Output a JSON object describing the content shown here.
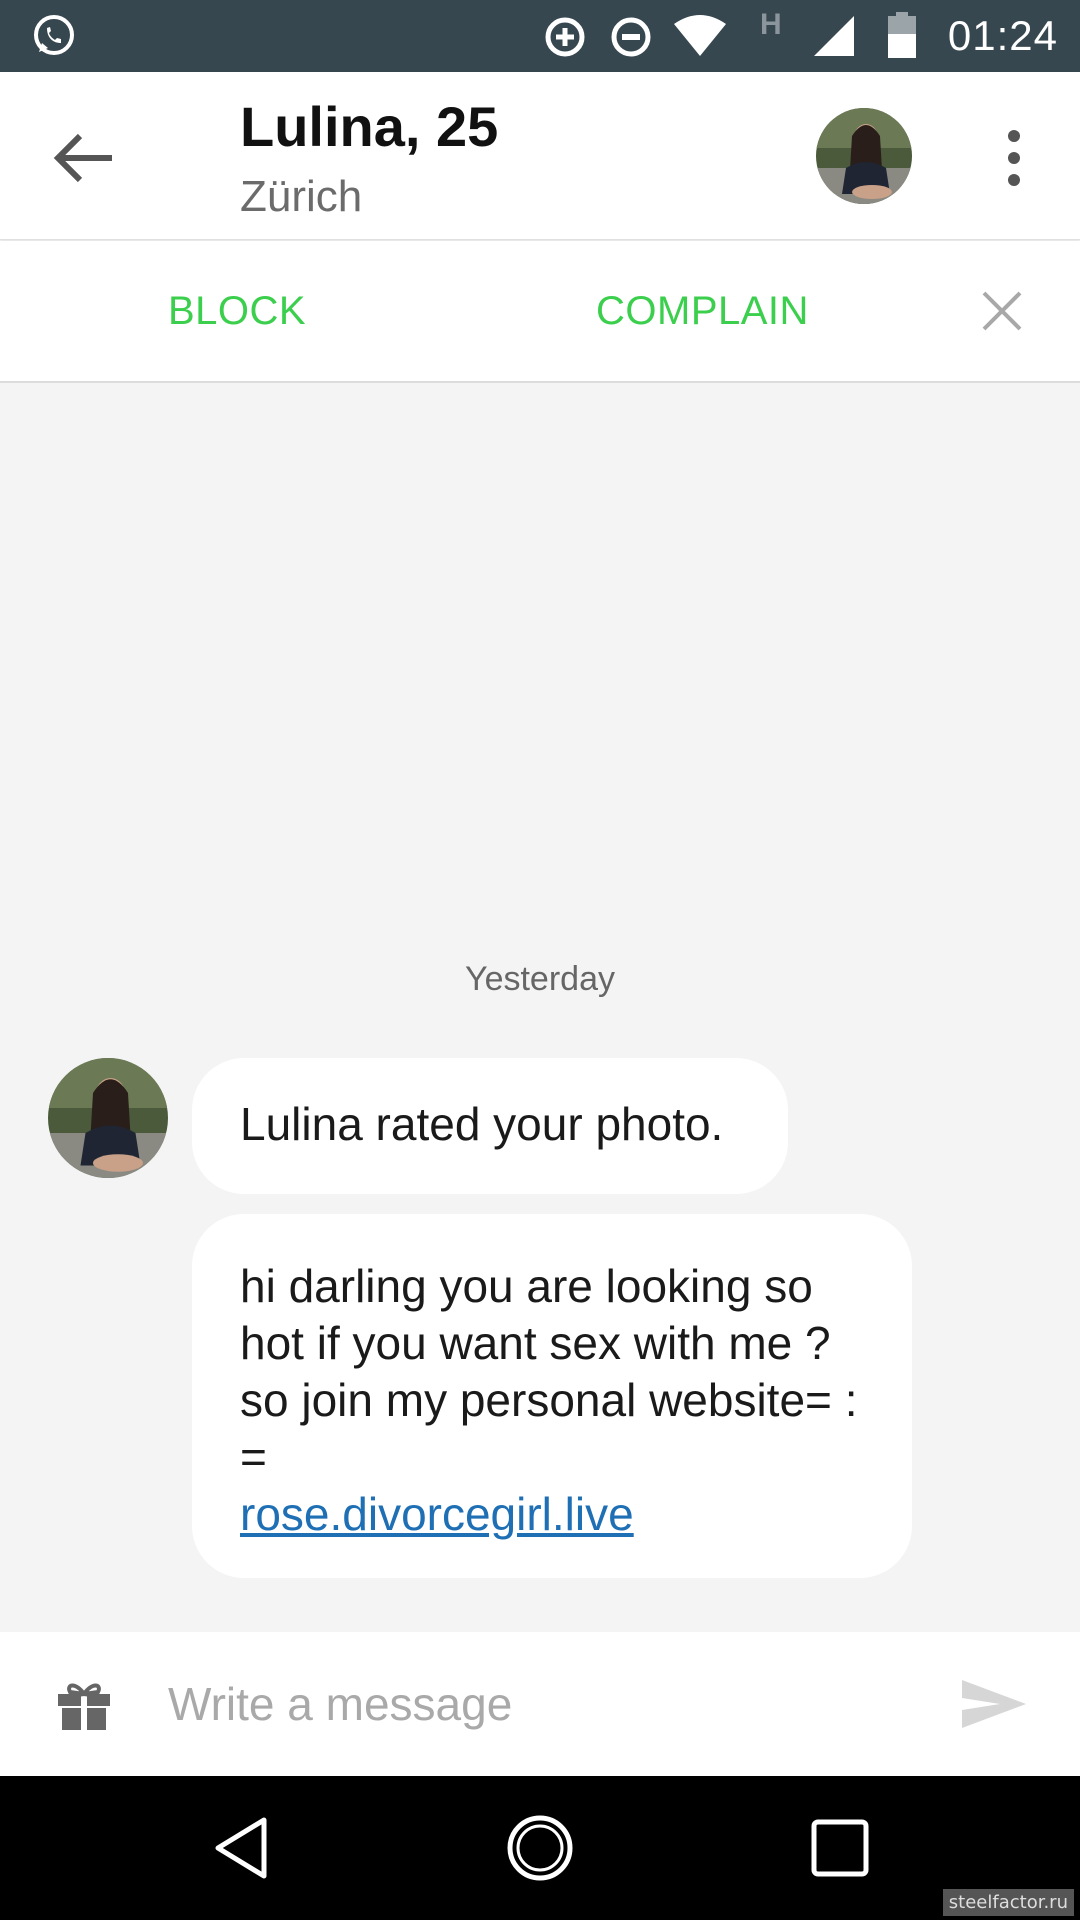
{
  "status_bar": {
    "time": "01:24",
    "network_indicator": "H",
    "icons": [
      "whatsapp-icon",
      "data-saver-icon",
      "do-not-disturb-icon",
      "wifi-icon",
      "cell-signal-icon",
      "battery-icon"
    ]
  },
  "header": {
    "name_age": "Lulina, 25",
    "city": "Zürich",
    "icons": [
      "back-arrow-icon",
      "avatar",
      "more-vert-icon"
    ]
  },
  "actions": {
    "block_label": "BLOCK",
    "complain_label": "COMPLAIN",
    "accent_color": "#3ccf4e"
  },
  "chat": {
    "date_separator": "Yesterday",
    "messages": [
      {
        "text": "Lulina rated your photo."
      },
      {
        "text": "hi darling you are looking so hot if you want sex with me ? so join my personal website= : =",
        "link": "rose.divorcegirl.live"
      }
    ]
  },
  "composer": {
    "placeholder": "Write a message",
    "icons": [
      "gift-icon",
      "send-icon"
    ]
  },
  "nav_bar": {
    "icons": [
      "nav-back-icon",
      "nav-home-icon",
      "nav-recents-icon"
    ]
  },
  "watermark": "steelfactor.ru"
}
